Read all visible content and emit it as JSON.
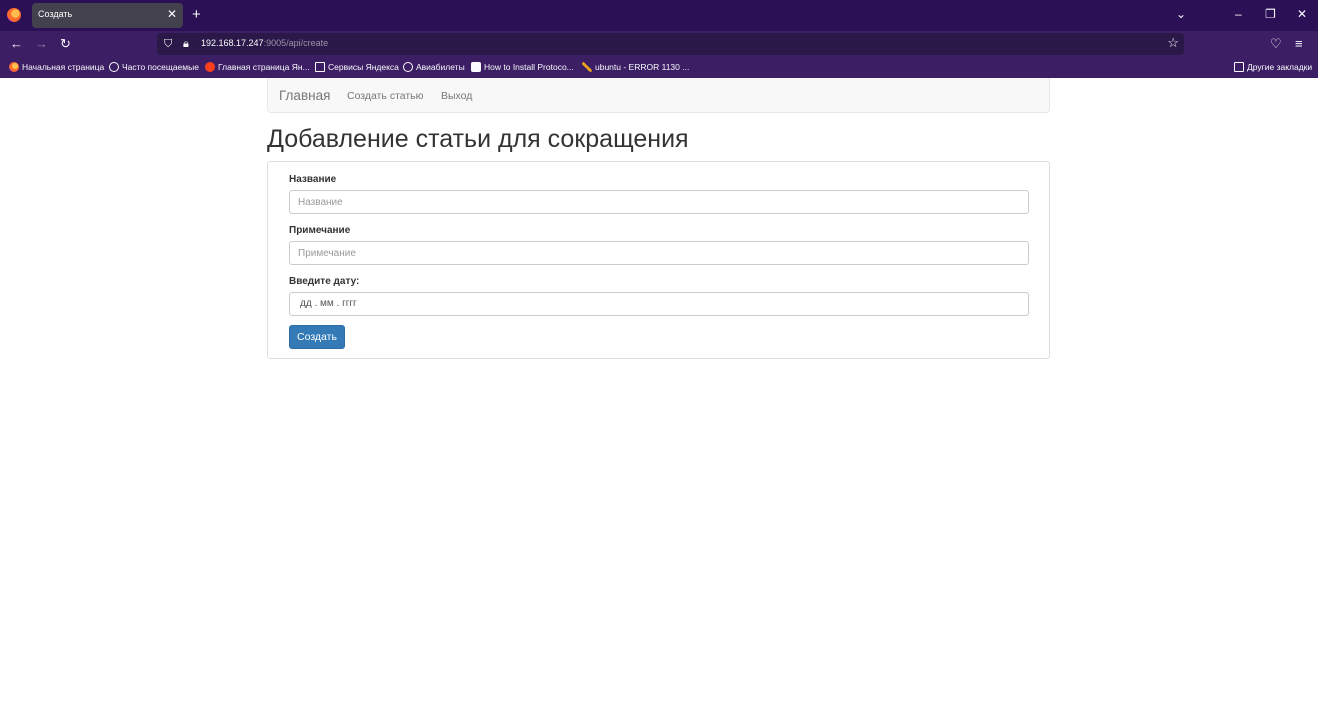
{
  "browser": {
    "tab": {
      "title": "Создать",
      "close_glyph": "✕"
    },
    "new_tab_glyph": "+",
    "url": {
      "host": "192.168.17.247",
      "path": ":9005/api/create"
    },
    "bookmarks": [
      {
        "label": "Начальная страница",
        "icon": "firefox-icon"
      },
      {
        "label": "Часто посещаемые",
        "icon": "gear-icon"
      },
      {
        "label": "Главная страница Ян...",
        "icon": "yandex-icon"
      },
      {
        "label": "Сервисы Яндекса",
        "icon": "folder-icon"
      },
      {
        "label": "Авиабилеты",
        "icon": "globe-icon"
      },
      {
        "label": "How to Install Protoco...",
        "icon": "site-icon"
      },
      {
        "label": "ubuntu - ERROR 1130 ...",
        "icon": "tool-icon"
      }
    ],
    "other_bookmarks": "Другие закладки"
  },
  "site": {
    "brand": "Главная",
    "nav": {
      "create": "Создать статью",
      "logout": "Выход"
    }
  },
  "page": {
    "title": "Добавление статьи для сокращения",
    "form": {
      "name_label": "Название",
      "name_placeholder": "Название",
      "note_label": "Примечание",
      "note_placeholder": "Примечание",
      "date_label": "Введите дату:",
      "date_placeholder": "дд . мм . гггг",
      "submit_label": "Создать"
    }
  }
}
